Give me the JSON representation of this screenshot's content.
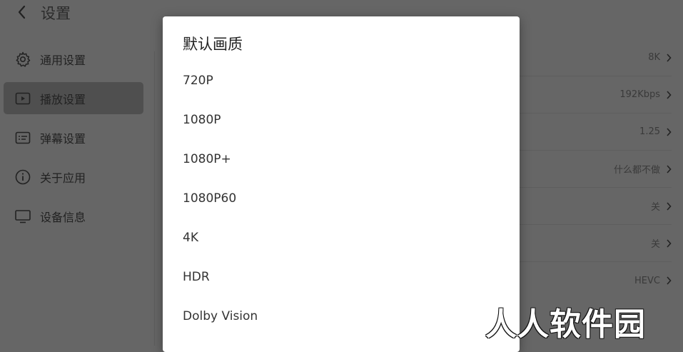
{
  "header": {
    "title": "设置",
    "back_icon": "chevron-left-icon"
  },
  "sidebar": {
    "items": [
      {
        "label": "通用设置",
        "icon": "gear-icon",
        "active": false
      },
      {
        "label": "播放设置",
        "icon": "play-icon",
        "active": true
      },
      {
        "label": "弹幕设置",
        "icon": "danmaku-icon",
        "active": false
      },
      {
        "label": "关于应用",
        "icon": "info-icon",
        "active": false
      },
      {
        "label": "设备信息",
        "icon": "monitor-icon",
        "active": false
      }
    ]
  },
  "settings": {
    "rows": [
      {
        "value": "8K"
      },
      {
        "value": "192Kbps"
      },
      {
        "value": "1.25"
      },
      {
        "value": "什么都不做"
      },
      {
        "value": "关"
      },
      {
        "value": "关"
      },
      {
        "value": "HEVC"
      }
    ]
  },
  "dialog": {
    "title": "默认画质",
    "options": [
      "720P",
      "1080P",
      "1080P+",
      "1080P60",
      "4K",
      "HDR",
      "Dolby Vision"
    ]
  },
  "watermark": {
    "text": "人人软件园"
  },
  "colors": {
    "dim_overlay": "#666666",
    "dialog_bg": "#ffffff",
    "active_item": "#4f4f4f"
  }
}
